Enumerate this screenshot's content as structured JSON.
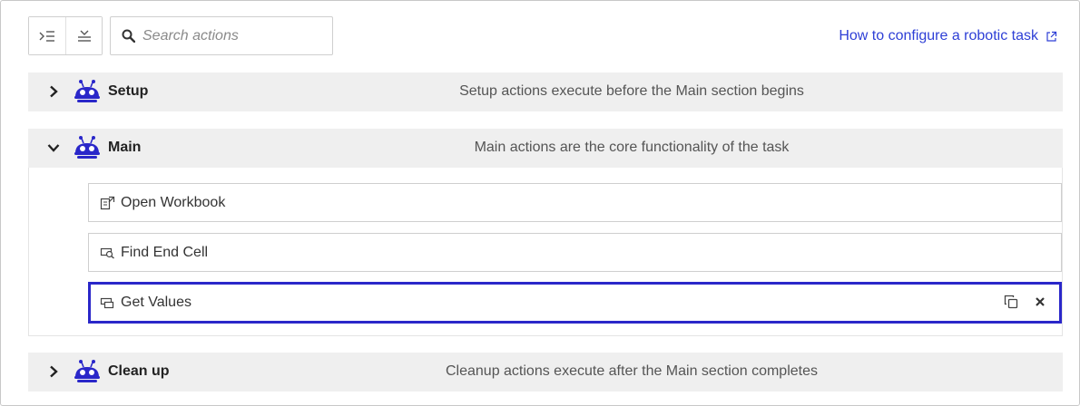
{
  "toolbar": {
    "expand_icon": "expand-all-icon",
    "collapse_icon": "collapse-all-icon",
    "search_placeholder": "Search actions",
    "search_value": ""
  },
  "help_link": {
    "label": "How to configure a robotic task",
    "icon": "external-link-icon"
  },
  "accent_color": "#2a27c9",
  "sections": {
    "setup": {
      "title": "Setup",
      "description": "Setup actions execute before the Main section begins",
      "expanded": false
    },
    "main": {
      "title": "Main",
      "description": "Main actions are the core functionality of the task",
      "expanded": true,
      "actions": [
        {
          "label": "Open Workbook",
          "icon": "open-workbook-icon",
          "selected": false
        },
        {
          "label": "Find End Cell",
          "icon": "find-cell-icon",
          "selected": false
        },
        {
          "label": "Get Values",
          "icon": "get-values-icon",
          "selected": true
        }
      ]
    },
    "cleanup": {
      "title": "Clean up",
      "description": "Cleanup actions execute after the Main section completes",
      "expanded": false
    }
  }
}
